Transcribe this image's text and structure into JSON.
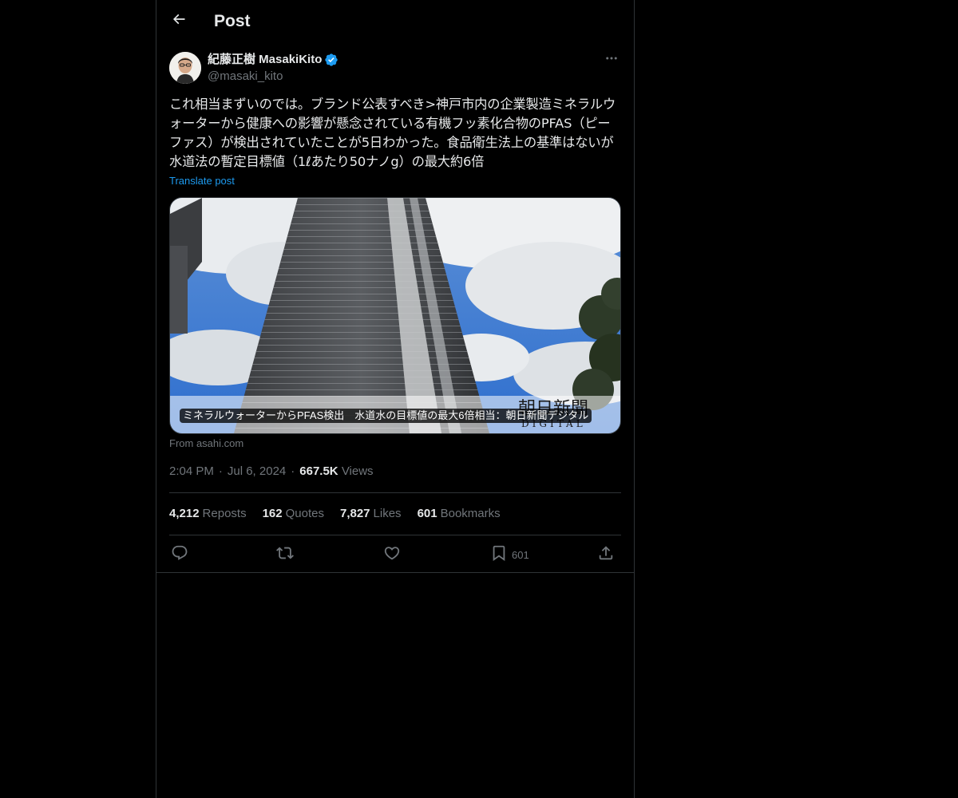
{
  "header": {
    "title": "Post"
  },
  "author": {
    "name": "紀藤正樹 MasakiKito",
    "handle": "@masaki_kito",
    "verified": true
  },
  "post": {
    "text": "これ相当まずいのでは。ブランド公表すべき>神戸市内の企業製造ミネラルウォーターから健康への影響が懸念されている有機フッ素化合物のPFAS（ピーファス）が検出されていたことが5日わかった。食品衛生法上の基準はないが水道法の暫定目標値（1ℓあたり50ナノg）の最大約6倍",
    "translate_label": "Translate post"
  },
  "card": {
    "caption": "ミネラルウォーターからPFAS検出　水道水の目標値の最大6倍相当：朝日新聞デジタル",
    "source": "From asahi.com",
    "watermark_line1": "朝日新聞",
    "watermark_line2": "DIGITAL"
  },
  "meta": {
    "time": "2:04 PM",
    "date": "Jul 6, 2024",
    "views_count": "667.5K",
    "views_label": "Views"
  },
  "stats": {
    "reposts_count": "4,212",
    "reposts_label": "Reposts",
    "quotes_count": "162",
    "quotes_label": "Quotes",
    "likes_count": "7,827",
    "likes_label": "Likes",
    "bookmarks_count": "601",
    "bookmarks_label": "Bookmarks"
  },
  "actions": {
    "bookmark_count": "601"
  },
  "icons": {
    "back": "arrow-left-icon",
    "verified": "verified-badge-icon",
    "more": "more-horizontal-icon",
    "reply": "reply-icon",
    "repost": "repost-icon",
    "like": "heart-icon",
    "bookmark": "bookmark-icon",
    "share": "share-icon"
  },
  "colors": {
    "background": "#000000",
    "accent": "#1d9bf0",
    "text_primary": "#e7e9ea",
    "text_secondary": "#71767b",
    "border": "#2f3336"
  }
}
